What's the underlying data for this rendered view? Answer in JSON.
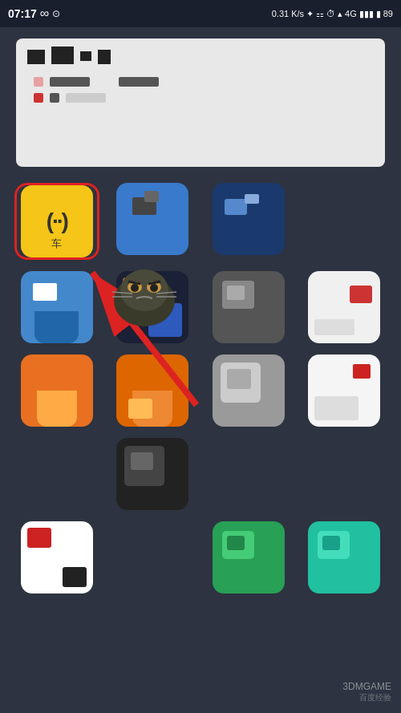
{
  "statusBar": {
    "time": "07:17",
    "battery": "89",
    "signal": "4G",
    "wifi": "on",
    "bluetooth": "on",
    "speed": "0.31 K/s"
  },
  "widget": {
    "visible": true
  },
  "apps": [
    {
      "id": "app-car",
      "label": "车",
      "color": "yellow",
      "highlighted": true,
      "row": 1,
      "col": 1
    },
    {
      "id": "app-blue1",
      "label": "",
      "color": "blue",
      "highlighted": false,
      "row": 1,
      "col": 2
    },
    {
      "id": "app-darkblue1",
      "label": "",
      "color": "darkblue",
      "highlighted": false,
      "row": 1,
      "col": 3
    },
    {
      "id": "app-placeholder1",
      "label": "",
      "color": "invisible",
      "highlighted": false,
      "row": 1,
      "col": 4
    },
    {
      "id": "app-blue2",
      "label": "",
      "color": "lightblue",
      "highlighted": false,
      "row": 2,
      "col": 1
    },
    {
      "id": "app-multi1",
      "label": "",
      "color": "multicolor",
      "highlighted": false,
      "row": 2,
      "col": 2
    },
    {
      "id": "app-gray1",
      "label": "",
      "color": "gray",
      "highlighted": false,
      "row": 2,
      "col": 3
    },
    {
      "id": "app-white1",
      "label": "",
      "color": "whitered",
      "highlighted": false,
      "row": 2,
      "col": 4
    },
    {
      "id": "app-orange1",
      "label": "",
      "color": "orange",
      "highlighted": false,
      "row": 3,
      "col": 1
    },
    {
      "id": "app-orange2",
      "label": "",
      "color": "orange2",
      "highlighted": false,
      "row": 3,
      "col": 2
    },
    {
      "id": "app-gray2",
      "label": "",
      "color": "gray2",
      "highlighted": false,
      "row": 3,
      "col": 3
    },
    {
      "id": "app-white2",
      "label": "",
      "color": "white2",
      "highlighted": false,
      "row": 3,
      "col": 4
    },
    {
      "id": "app-placeholder2",
      "label": "",
      "color": "invisible",
      "highlighted": false,
      "row": 4,
      "col": 1
    },
    {
      "id": "app-dark1",
      "label": "",
      "color": "dark",
      "highlighted": false,
      "row": 4,
      "col": 2
    },
    {
      "id": "app-placeholder3",
      "label": "",
      "color": "invisible",
      "highlighted": false,
      "row": 4,
      "col": 3
    },
    {
      "id": "app-placeholder4",
      "label": "",
      "color": "invisible",
      "highlighted": false,
      "row": 4,
      "col": 4
    },
    {
      "id": "app-whiteblack",
      "label": "",
      "color": "whiteblack",
      "highlighted": false,
      "row": 5,
      "col": 1
    },
    {
      "id": "app-placeholder5",
      "label": "",
      "color": "invisible",
      "highlighted": false,
      "row": 5,
      "col": 2
    },
    {
      "id": "app-green1",
      "label": "",
      "color": "green",
      "highlighted": false,
      "row": 5,
      "col": 3
    },
    {
      "id": "app-cyan1",
      "label": "",
      "color": "cyan",
      "highlighted": false,
      "row": 5,
      "col": 4
    }
  ],
  "watermark": {
    "text": "3DMGAME",
    "subtext": "百度经验"
  },
  "arrow": {
    "visible": true,
    "color": "#dd2222"
  }
}
